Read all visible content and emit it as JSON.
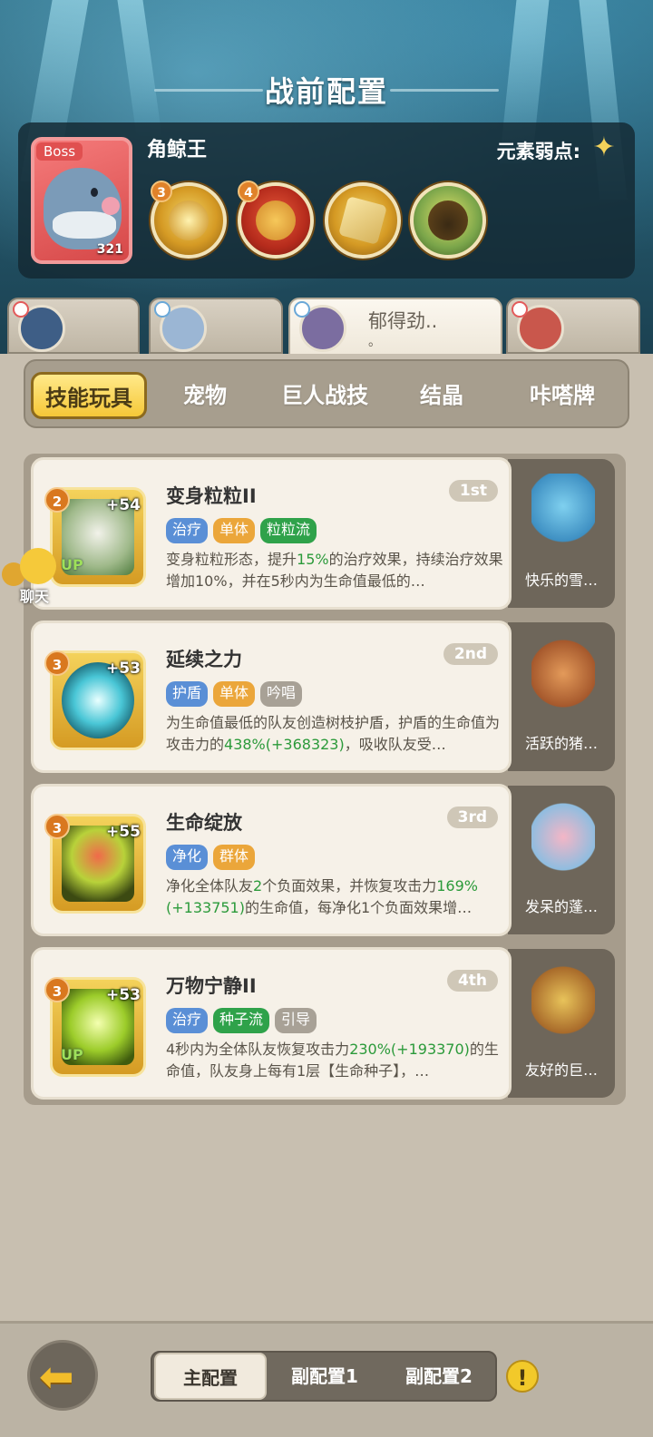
{
  "page_title": "战前配置",
  "boss": {
    "tag": "Boss",
    "name": "角鲸王",
    "level": "321",
    "weakness_label": "元素弱点:",
    "skills": [
      {
        "level": "3",
        "icon": "star-burst-icon"
      },
      {
        "level": "4",
        "icon": "fist-stars-icon"
      },
      {
        "level": "",
        "icon": "cube-icon"
      },
      {
        "level": "",
        "icon": "shadow-creature-icon"
      }
    ]
  },
  "team_tabs": [
    {
      "name": "",
      "sub": ""
    },
    {
      "name": "",
      "sub": ""
    },
    {
      "name": "郁得劲..",
      "sub": "。"
    },
    {
      "name": "",
      "sub": ""
    }
  ],
  "categories": [
    "技能玩具",
    "宠物",
    "巨人战技",
    "结晶",
    "咔嗒牌"
  ],
  "chat_label": "聊天",
  "skills": [
    {
      "level": "2",
      "plus": "+54",
      "up": "UP",
      "name": "变身粒粒II",
      "rank": "1st",
      "tags": [
        {
          "text": "治疗",
          "color": "blue"
        },
        {
          "text": "单体",
          "color": "orange"
        },
        {
          "text": "粒粒流",
          "color": "green"
        }
      ],
      "desc_parts": [
        "变身粒粒形态，提升",
        "15%",
        "的治疗效果，持续治疗效果增加10%，并在5秒内为生命值最低的…"
      ],
      "pet_name": "快乐的雪…"
    },
    {
      "level": "3",
      "plus": "+53",
      "up": "",
      "name": "延续之力",
      "rank": "2nd",
      "tags": [
        {
          "text": "护盾",
          "color": "blue"
        },
        {
          "text": "单体",
          "color": "orange"
        },
        {
          "text": "吟唱",
          "color": "gray"
        }
      ],
      "desc_parts": [
        "为生命值最低的队友创造树枝护盾，护盾的生命值为攻击力的",
        "438%(+368323)",
        "，吸收队友受…"
      ],
      "pet_name": "活跃的猪…"
    },
    {
      "level": "3",
      "plus": "+55",
      "up": "",
      "name": "生命绽放",
      "rank": "3rd",
      "tags": [
        {
          "text": "净化",
          "color": "blue"
        },
        {
          "text": "群体",
          "color": "orange"
        }
      ],
      "desc_parts": [
        "净化全体队友",
        "2",
        "个负面效果，并恢复攻击力",
        "169%(+133751)",
        "的生命值，每净化1个负面效果增…"
      ],
      "pet_name": "发呆的蓬…"
    },
    {
      "level": "3",
      "plus": "+53",
      "up": "UP",
      "name": "万物宁静II",
      "rank": "4th",
      "tags": [
        {
          "text": "治疗",
          "color": "blue"
        },
        {
          "text": "种子流",
          "color": "green"
        },
        {
          "text": "引导",
          "color": "gray"
        }
      ],
      "desc_parts": [
        "4秒内为全体队友恢复攻击力",
        "230%(+193370)",
        "的生命值，队友身上每有1层【生命种子】，…"
      ],
      "pet_name": "友好的巨…"
    }
  ],
  "config_tabs": [
    "主配置",
    "副配置1",
    "副配置2"
  ],
  "warn_symbol": "!"
}
